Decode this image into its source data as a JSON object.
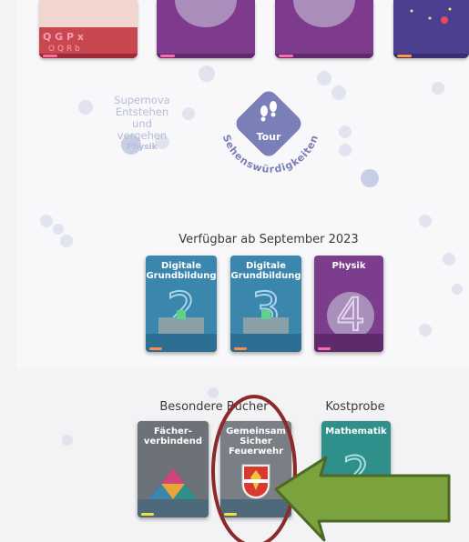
{
  "tour": {
    "button_label": "Tour",
    "arc_text": "Sehenswürdigkeiten"
  },
  "supernova": {
    "lines": [
      "Supernova",
      "Entstehen",
      "und",
      "vergehen"
    ],
    "subject": "Physik"
  },
  "september_section": {
    "title": "Verfügbar ab September 2023",
    "books": [
      {
        "title_line1": "Digitale",
        "title_line2": "Grundbildung",
        "number": "2",
        "color": "#3a86ad"
      },
      {
        "title_line1": "Digitale",
        "title_line2": "Grundbildung",
        "number": "3",
        "color": "#3a86ad"
      },
      {
        "title_line1": "Physik",
        "title_line2": "",
        "number": "4",
        "color": "#7b3d8c"
      }
    ]
  },
  "special_section": {
    "title": "Besondere Bücher",
    "books": [
      {
        "title_line1": "Fächer-",
        "title_line2": "verbindend",
        "color": "#6d7178"
      },
      {
        "title_line1": "Gemeinsam",
        "title_line2": "Sicher",
        "title_line3": "Feuerwehr",
        "color": "#7a7f86"
      }
    ]
  },
  "sample_section": {
    "title": "Kostprobe",
    "book": {
      "title_line1": "Mathematik",
      "number": "2",
      "color": "#2f8f8a"
    }
  },
  "top_cards": {
    "card1_letters": "Q G P x O Q R b"
  },
  "colors": {
    "highlight_circle": "#8b2a2a",
    "arrow_fill": "#7ba23c",
    "arrow_stroke": "#4d6a25",
    "tour_badge": "#7a7fb8",
    "physics_purple": "#7b3d8c",
    "digital_blue": "#3a86ad"
  }
}
